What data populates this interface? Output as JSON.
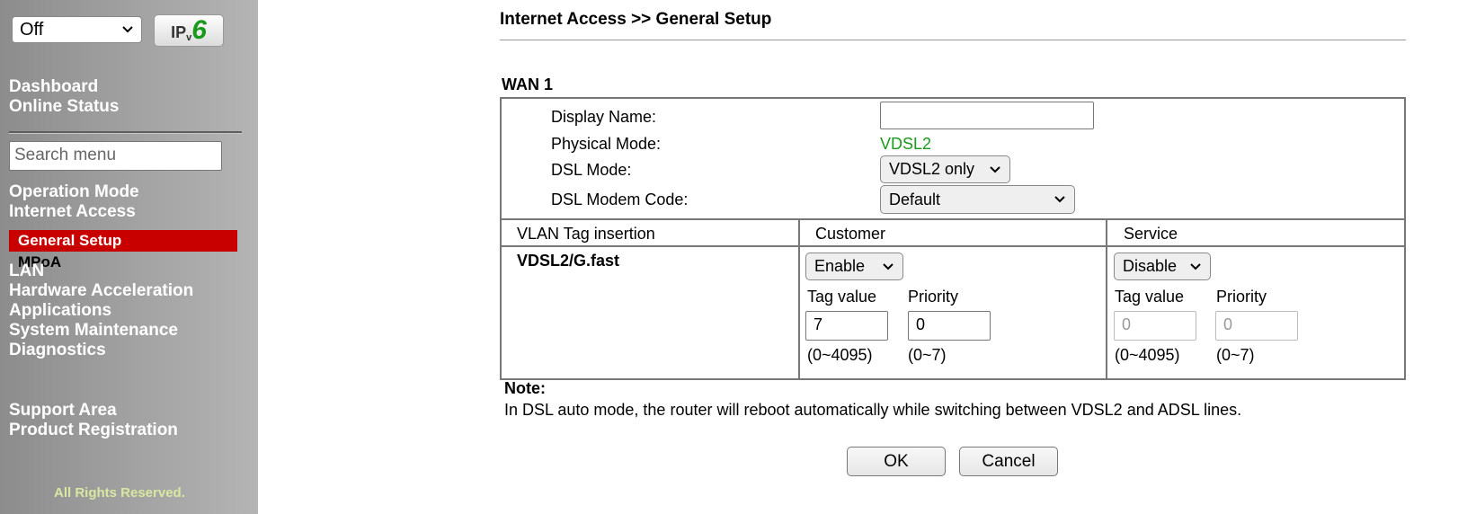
{
  "sidebar": {
    "ipv_select_value": "Off",
    "ipv6_label_ip": "IP",
    "ipv6_label_v": "v",
    "ipv6_label_6": "6",
    "nav_top": [
      "Dashboard",
      "Online Status"
    ],
    "search_placeholder": "Search menu",
    "nav_main": [
      "Operation Mode",
      "Internet Access"
    ],
    "active_item": "General Setup",
    "sub_item": "MPoA",
    "nav_rest": [
      "LAN",
      "Hardware Acceleration",
      "Applications",
      "System Maintenance",
      "Diagnostics"
    ],
    "support": [
      "Support Area",
      "Product Registration"
    ],
    "rights": "All Rights Reserved."
  },
  "main": {
    "title": "Internet Access >> General Setup",
    "wan_label": "WAN 1",
    "display_name_label": "Display Name:",
    "display_name_value": "",
    "physical_mode_label": "Physical Mode:",
    "physical_mode_value": "VDSL2",
    "dsl_mode_label": "DSL Mode:",
    "dsl_mode_value": "VDSL2 only",
    "modem_code_label": "DSL Modem Code:",
    "modem_code_value": "Default",
    "vlan_header": "VLAN Tag insertion",
    "customer_header": "Customer",
    "service_header": "Service",
    "row_label": "VDSL2/G.fast",
    "customer": {
      "state": "Enable",
      "tag_label": "Tag value",
      "priority_label": "Priority",
      "tag_value": "7",
      "priority_value": "0",
      "tag_range": "(0~4095)",
      "priority_range": "(0~7)"
    },
    "service": {
      "state": "Disable",
      "tag_label": "Tag value",
      "priority_label": "Priority",
      "tag_value": "0",
      "priority_value": "0",
      "tag_range": "(0~4095)",
      "priority_range": "(0~7)"
    },
    "note_title": "Note:",
    "note_text": "In DSL auto mode, the router will reboot automatically while switching between VDSL2 and ADSL lines.",
    "ok_label": "OK",
    "cancel_label": "Cancel"
  },
  "colors": {
    "active_nav_bg": "#c90000",
    "physical_mode_green": "#1a9a1a",
    "ipv6_green": "#1a9a1a"
  }
}
